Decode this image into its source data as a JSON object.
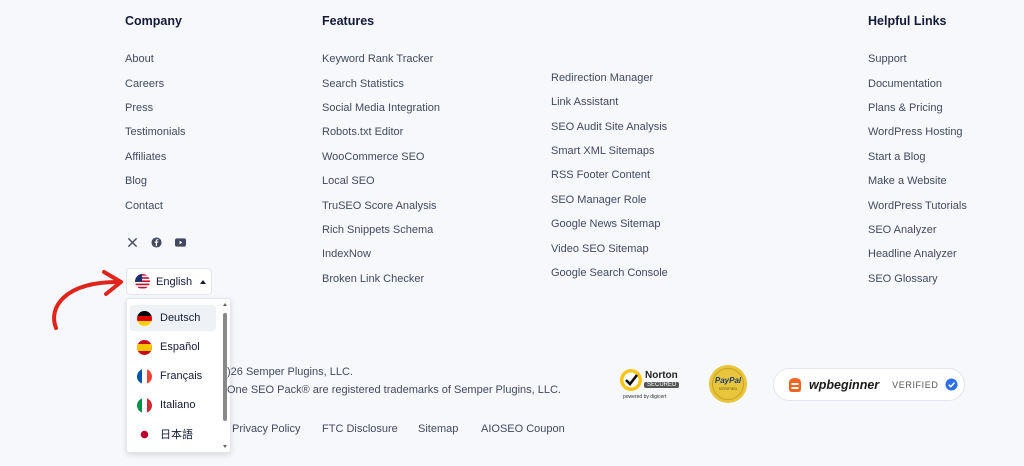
{
  "company": {
    "heading": "Company",
    "links": [
      "About",
      "Careers",
      "Press",
      "Testimonials",
      "Affiliates",
      "Blog",
      "Contact"
    ]
  },
  "features": {
    "heading": "Features",
    "col1": [
      "Keyword Rank Tracker",
      "Search Statistics",
      "Social Media Integration",
      "Robots.txt Editor",
      "WooCommerce SEO",
      "Local SEO",
      "TruSEO Score Analysis",
      "Rich Snippets Schema",
      "IndexNow",
      "Broken Link Checker"
    ],
    "col2": [
      "Redirection Manager",
      "Link Assistant",
      "SEO Audit Site Analysis",
      "Smart XML Sitemaps",
      "RSS Footer Content",
      "SEO Manager Role",
      "Google News Sitemap",
      "Video SEO Sitemap",
      "Google Search Console"
    ]
  },
  "helpful": {
    "heading": "Helpful Links",
    "links": [
      "Support",
      "Documentation",
      "Plans & Pricing",
      "WordPress Hosting",
      "Start a Blog",
      "Make a Website",
      "WordPress Tutorials",
      "SEO Analyzer",
      "Headline Analyzer",
      "SEO Glossary"
    ]
  },
  "social": [
    "x-icon",
    "facebook-icon",
    "youtube-icon"
  ],
  "language": {
    "current": "English",
    "options": [
      "Deutsch",
      "Español",
      "Français",
      "Italiano",
      "日本語"
    ]
  },
  "copyright": {
    "line1": ")26 Semper Plugins, LLC.",
    "line2": "One SEO Pack® are registered trademarks of Semper Plugins, LLC."
  },
  "bottom_links": [
    "Privacy Policy",
    "FTC Disclosure",
    "Sitemap",
    "AIOSEO Coupon"
  ],
  "badges": {
    "norton_title": "Norton",
    "norton_sub": "SECURED",
    "norton_powered": "powered by digicert",
    "paypal": "PayPal",
    "paypal_sub": "VERIFIED",
    "wpbeginner": "wpbeginner",
    "wpb_verified": "VERIFIED"
  },
  "colors": {
    "background": "#f6f8fb",
    "text": "#434960",
    "heading": "#141b38",
    "arrow": "#e0241b",
    "verified_blue": "#2c6fe6"
  }
}
